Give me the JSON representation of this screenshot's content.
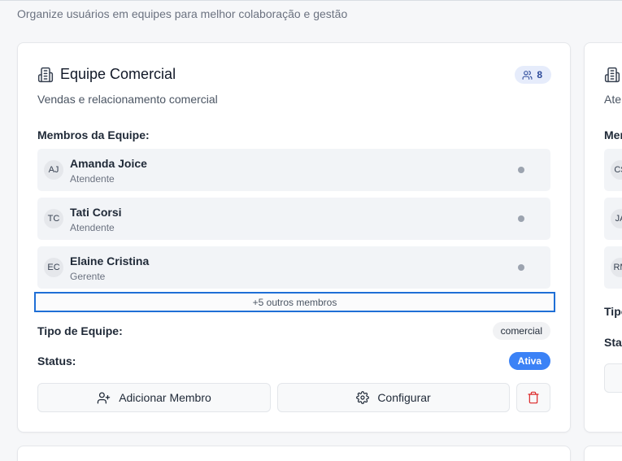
{
  "page": {
    "subtitle": "Organize usuários em equipes para melhor colaboração e gestão"
  },
  "team": {
    "name": "Equipe Comercial",
    "member_count": "8",
    "description": "Vendas e relacionamento comercial",
    "members_label": "Membros da Equipe:",
    "members": [
      {
        "initials": "AJ",
        "name": "Amanda Joice",
        "role": "Atendente"
      },
      {
        "initials": "TC",
        "name": "Tati Corsi",
        "role": "Atendente"
      },
      {
        "initials": "EC",
        "name": "Elaine Cristina",
        "role": "Gerente"
      }
    ],
    "more_members": "+5 outros membros",
    "type_label": "Tipo de Equipe:",
    "type_value": "comercial",
    "status_label": "Status:",
    "status_value": "Ativa",
    "add_member_label": "Adicionar Membro",
    "configure_label": "Configurar"
  },
  "peek_card": {
    "desc_fragment": "Ate",
    "members_fragment": "Mer",
    "member_initials": [
      "CS",
      "JA",
      "RM"
    ],
    "type_fragment": "Tipo",
    "status_fragment": "Stat"
  },
  "colors": {
    "accent": "#3b82f6",
    "focus_outline": "#1f6fd6",
    "badge_bg": "#e6ecfb",
    "delete": "#dc2626"
  },
  "icons": {
    "team_icon": "building-icon",
    "count_icon": "users-icon",
    "add_icon": "user-plus-icon",
    "configure_icon": "gear-icon",
    "delete_icon": "trash-icon"
  }
}
